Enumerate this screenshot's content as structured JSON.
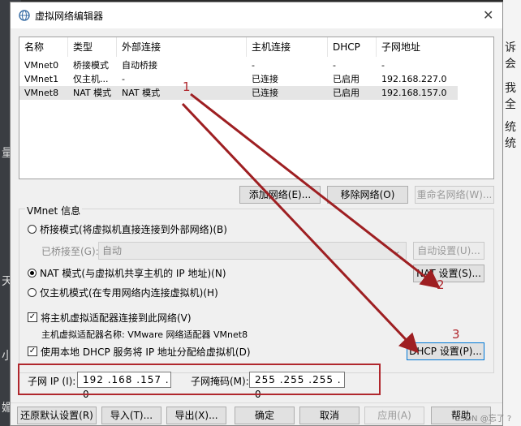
{
  "window": {
    "title": "虚拟网络编辑器"
  },
  "table": {
    "headers": [
      "名称",
      "类型",
      "外部连接",
      "主机连接",
      "DHCP",
      "子网地址"
    ],
    "rows": [
      [
        "VMnet0",
        "桥接模式",
        "自动桥接",
        "-",
        "-",
        "-"
      ],
      [
        "VMnet1",
        "仅主机...",
        "-",
        "已连接",
        "已启用",
        "192.168.227.0"
      ],
      [
        "VMnet8",
        "NAT 模式",
        "NAT 模式",
        "已连接",
        "已启用",
        "192.168.157.0"
      ]
    ]
  },
  "list_buttons": {
    "add": "添加网络(E)...",
    "remove": "移除网络(O)",
    "rename": "重命名网络(W)..."
  },
  "vmnet_info": {
    "group_label": "VMnet 信息",
    "bridge_radio": "桥接模式(将虚拟机直接连接到外部网络)(B)",
    "bridged_to_label": "已桥接至(G):",
    "bridged_to_value": "自动",
    "auto_settings": "自动设置(U)...",
    "nat_radio": "NAT 模式(与虚拟机共享主机的 IP 地址)(N)",
    "nat_settings": "NAT 设置(S)...",
    "hostonly_radio": "仅主机模式(在专用网络内连接虚拟机)(H)",
    "connect_adapter": "将主机虚拟适配器连接到此网络(V)",
    "adapter_name": "主机虚拟适配器名称: VMware 网络适配器 VMnet8",
    "use_dhcp": "使用本地 DHCP 服务将 IP 地址分配给虚拟机(D)",
    "dhcp_settings": "DHCP 设置(P)...",
    "subnet_ip_label": "子网 IP (I):",
    "subnet_ip": "192 .168 .157 . 0",
    "subnet_mask_label": "子网掩码(M):",
    "subnet_mask": "255 .255 .255 . 0"
  },
  "bottom_buttons": {
    "restore": "还原默认设置(R)",
    "import": "导入(T)...",
    "export": "导出(X)...",
    "ok": "确定",
    "cancel": "取消",
    "apply": "应用(A)",
    "help": "帮助"
  },
  "annotations": {
    "a1": "1",
    "a2": "2",
    "a3": "3"
  },
  "colors": {
    "annotation": "#b0272d",
    "dialog_bg": "#f0f0f0"
  },
  "background_text": {
    "r1": "诉会",
    "r2": "我全",
    "r3": "统统",
    "l1": "量",
    "l2": "天",
    "l3": "小",
    "l4": "媚",
    "watermark": "CSDN @忘了 ?"
  }
}
